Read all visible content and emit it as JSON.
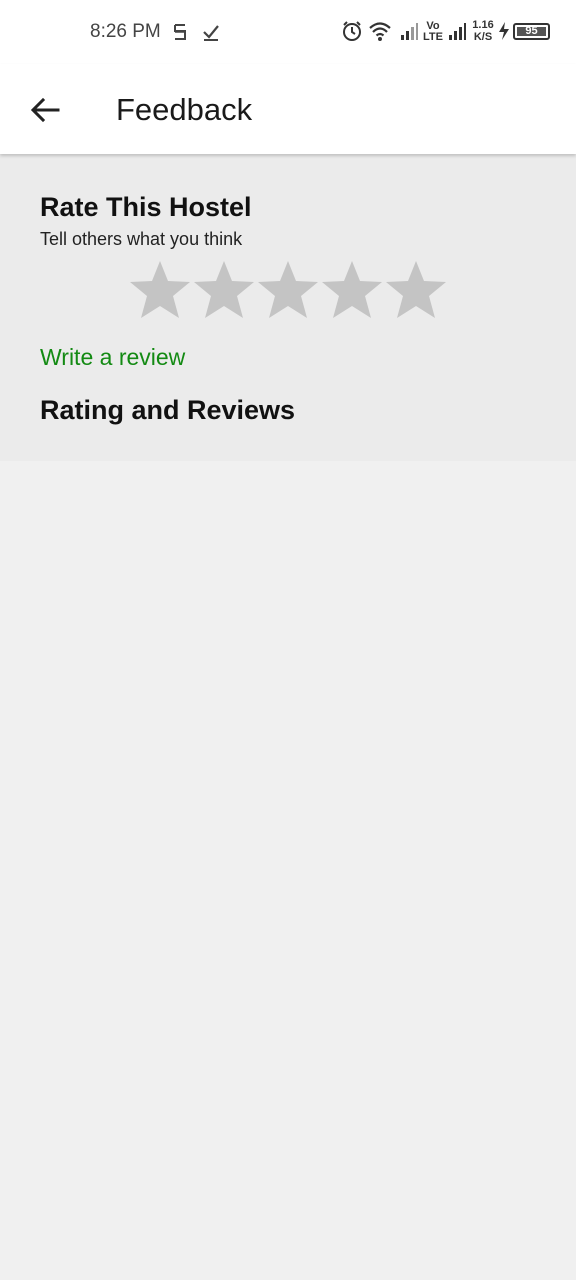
{
  "status_bar": {
    "time": "8:26 PM",
    "network_type": "Vo\nLTE",
    "speed_value": "1.16",
    "speed_unit": "K/S",
    "battery": "95"
  },
  "app_bar": {
    "title": "Feedback",
    "back_icon": "arrow-left-icon"
  },
  "rating": {
    "title": "Rate This Hostel",
    "subtitle": "Tell others what you think",
    "stars_max": 5,
    "stars_selected": 0,
    "star_color": "#c4c4c4",
    "write_review_label": "Write a review",
    "write_review_color": "#138a13"
  },
  "reviews": {
    "heading": "Rating and Reviews"
  }
}
